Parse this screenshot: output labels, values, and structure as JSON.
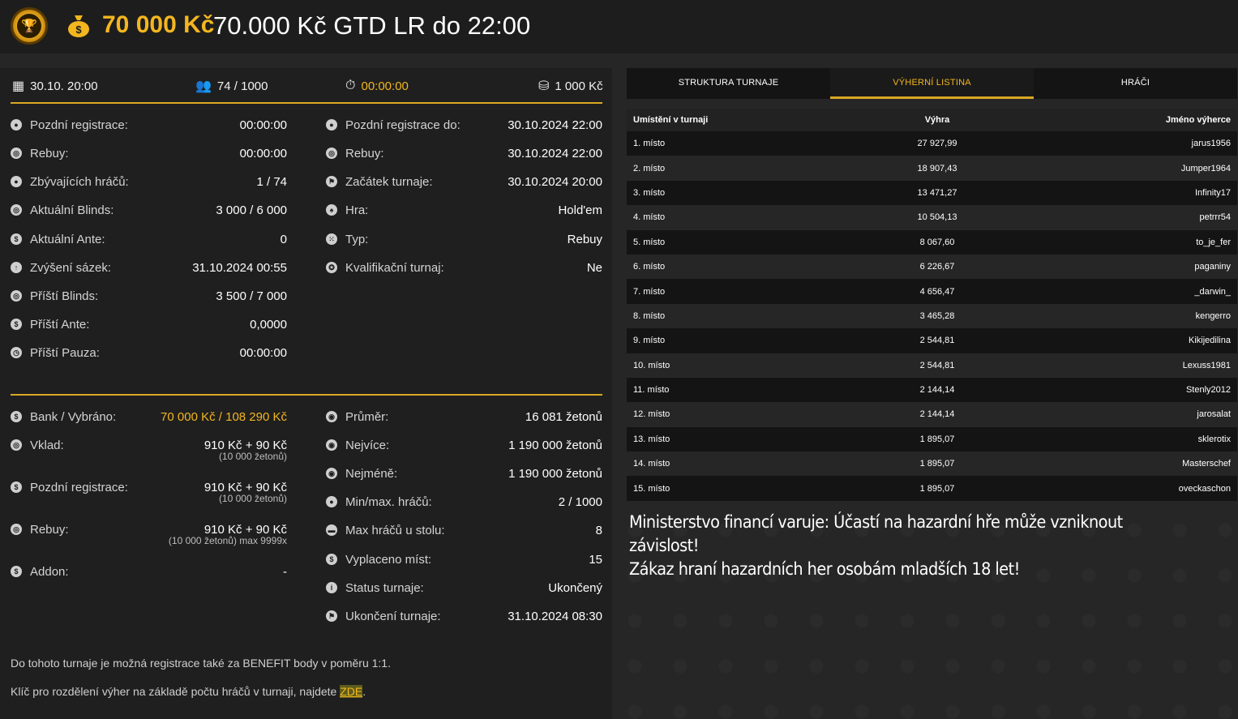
{
  "header": {
    "prize": "70 000 Kč",
    "title": "70.000 Kč GTD LR do 22:00"
  },
  "summary": {
    "date": "30.10. 20:00",
    "players": "74 / 1000",
    "timer": "00:00:00",
    "buyin": "1 000 Kč"
  },
  "info_left": [
    {
      "label": "Pozdní registrace:",
      "value": "00:00:00",
      "icon": "user-icon"
    },
    {
      "label": "Rebuy:",
      "value": "00:00:00",
      "icon": "chips-icon"
    },
    {
      "label": "Zbývajících hráčů:",
      "value": "1 / 74",
      "icon": "users-icon"
    },
    {
      "label": "Aktuální Blinds:",
      "value": "3 000 / 6 000",
      "icon": "chips-icon"
    },
    {
      "label": "Aktuální Ante:",
      "value": "0",
      "icon": "coin-icon"
    },
    {
      "label": "Zvýšení sázek:",
      "value": "31.10.2024 00:55",
      "icon": "arrow-up-icon"
    },
    {
      "label": "Příští Blinds:",
      "value": "3 500 / 7 000",
      "icon": "chips-icon"
    },
    {
      "label": "Příští Ante:",
      "value": "0,0000",
      "icon": "coin-icon"
    },
    {
      "label": "Příští Pauza:",
      "value": "00:00:00",
      "icon": "clock-icon"
    }
  ],
  "info_right": [
    {
      "label": "Pozdní registrace do:",
      "value": "30.10.2024 22:00",
      "icon": "user-icon"
    },
    {
      "label": "Rebuy:",
      "value": "30.10.2024 22:00",
      "icon": "chips-icon"
    },
    {
      "label": "Začátek turnaje:",
      "value": "30.10.2024 20:00",
      "icon": "flag-icon"
    },
    {
      "label": "Hra:",
      "value": "Hold'em",
      "icon": "cards-icon"
    },
    {
      "label": "Typ:",
      "value": "Rebuy",
      "icon": "dice-icon"
    },
    {
      "label": "Kvalifikační turnaj:",
      "value": "Ne",
      "icon": "medal-icon"
    }
  ],
  "bank_left": [
    {
      "label": "Bank / Vybráno:",
      "value": "70 000 Kč / 108 290 Kč",
      "sub": "",
      "icon": "bag-icon"
    },
    {
      "label": "Vklad:",
      "value": "910 Kč + 90 Kč",
      "sub": "(10 000 žetonů)",
      "icon": "chips-icon"
    },
    {
      "label": "Pozdní registrace:",
      "value": "910 Kč + 90 Kč",
      "sub": "(10 000 žetonů)",
      "icon": "coin-icon"
    },
    {
      "label": "Rebuy:",
      "value": "910 Kč + 90 Kč",
      "sub": "(10 000 žetonů) max 9999x",
      "icon": "chips-icon"
    },
    {
      "label": "Addon:",
      "value": "-",
      "sub": "",
      "icon": "coin-icon"
    }
  ],
  "bank_right": [
    {
      "label": "Průměr:",
      "value": "16 081 žetonů",
      "icon": "chip-icon"
    },
    {
      "label": "Nejvíce:",
      "value": "1 190 000 žetonů",
      "icon": "chip-icon"
    },
    {
      "label": "Nejméně:",
      "value": "1 190 000 žetonů",
      "icon": "chip-icon"
    },
    {
      "label": "Min/max. hráčů:",
      "value": "2 / 1000",
      "icon": "users-icon"
    },
    {
      "label": "Max hráčů u stolu:",
      "value": "8",
      "icon": "table-icon"
    },
    {
      "label": "Vyplaceno míst:",
      "value": "15",
      "icon": "money-icon"
    },
    {
      "label": "Status turnaje:",
      "value": "Ukončený",
      "icon": "info-icon"
    },
    {
      "label": "Ukončení turnaje:",
      "value": "31.10.2024 08:30",
      "icon": "flag-icon"
    }
  ],
  "notes": {
    "benefit": "Do tohoto turnaje je možná registrace také za BENEFIT body v poměru 1:1.",
    "key_text": "Klíč pro rozdělení výher na základě počtu hráčů v turnaji, najdete ",
    "key_link": "ZDE",
    "key_end": "."
  },
  "tabs": [
    "STRUKTURA TURNAJE",
    "VÝHERNÍ LISTINA",
    "HRÁČI"
  ],
  "prize_table": {
    "headers": [
      "Umístění v turnaji",
      "Výhra",
      "Jméno výherce"
    ],
    "rows": [
      [
        "1. místo",
        "27 927,99",
        "jarus1956"
      ],
      [
        "2. místo",
        "18 907,43",
        "Jumper1964"
      ],
      [
        "3. místo",
        "13 471,27",
        "Infinity17"
      ],
      [
        "4. místo",
        "10 504,13",
        "petrrr54"
      ],
      [
        "5. místo",
        "8 067,60",
        "to_je_fer"
      ],
      [
        "6. místo",
        "6 226,67",
        "paganiny"
      ],
      [
        "7. místo",
        "4 656,47",
        "_darwin_"
      ],
      [
        "8. místo",
        "3 465,28",
        "kengerro"
      ],
      [
        "9. místo",
        "2 544,81",
        "Kikijedilina"
      ],
      [
        "10. místo",
        "2 544,81",
        "Lexuss1981"
      ],
      [
        "11. místo",
        "2 144,14",
        "Stenly2012"
      ],
      [
        "12. místo",
        "2 144,14",
        "jarosalat"
      ],
      [
        "13. místo",
        "1 895,07",
        "sklerotix"
      ],
      [
        "14. místo",
        "1 895,07",
        "Masterschef"
      ],
      [
        "15. místo",
        "1 895,07",
        "oveckaschon"
      ]
    ]
  },
  "warning": {
    "line1": "Ministerstvo financí varuje: Účastí na hazardní hře může vzniknout závislost!",
    "line2": "Zákaz hraní hazardních her osobám mladších 18 let!"
  }
}
